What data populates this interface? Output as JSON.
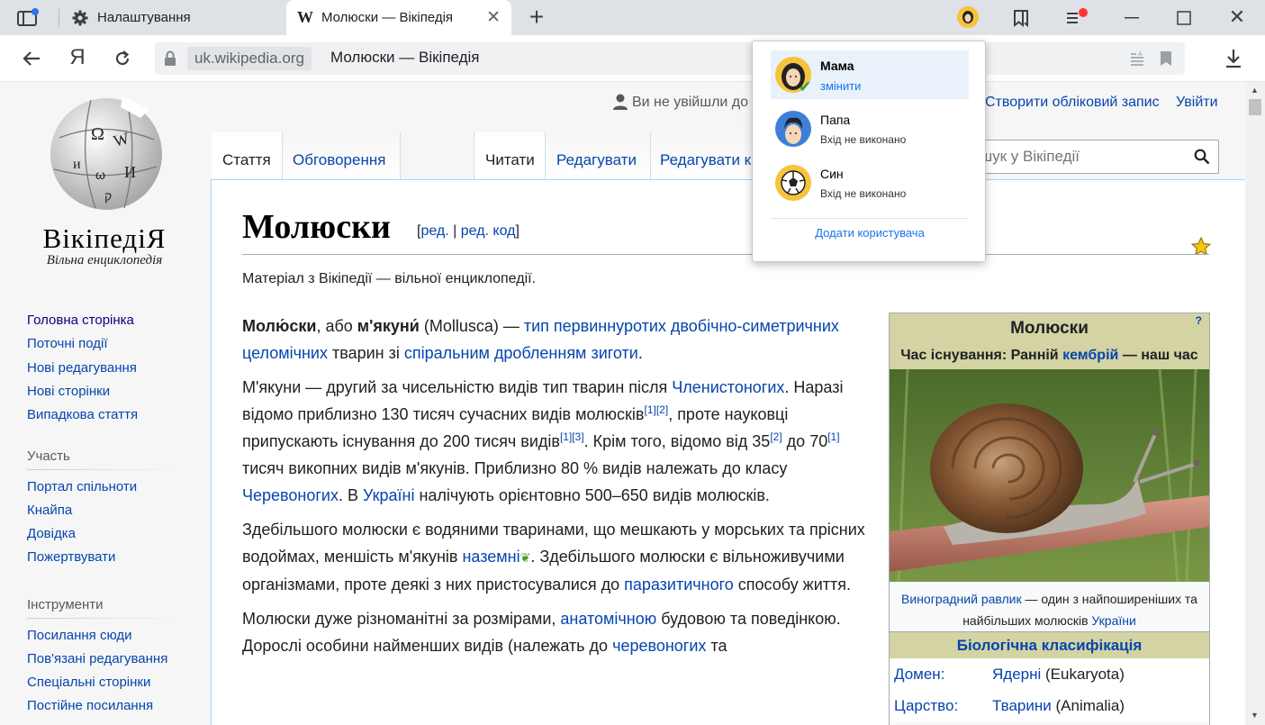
{
  "browser": {
    "tabs": [
      {
        "title": "Налаштування",
        "icon": "gear-icon"
      },
      {
        "title": "Молюски — Вікіпедія",
        "icon": "wikipedia-w-icon"
      }
    ],
    "url_domain": "uk.wikipedia.org",
    "url_title": "Молюски — Вікіпедія",
    "yandex_button": "Я"
  },
  "profile_menu": {
    "users": [
      {
        "name": "Мама",
        "status": "змінити",
        "active": true
      },
      {
        "name": "Папа",
        "status": "Вхід не виконано",
        "active": false
      },
      {
        "name": "Син",
        "status": "Вхід не виконано",
        "active": false
      }
    ],
    "add_user": "Додати користувача"
  },
  "wiki": {
    "logo_word": "ВікіпедіЯ",
    "logo_tagline": "Вільна енциклопедія",
    "user_links": {
      "not_logged": "Ви не увійшли до",
      "create_account": "Створити обліковий запис",
      "login": "Увійти"
    },
    "tabs": {
      "article": "Стаття",
      "talk": "Обговорення",
      "read": "Читати",
      "edit": "Редагувати",
      "edit_source": "Редагувати к"
    },
    "search_placeholder": "ошук у Вікіпедії",
    "sidebar": {
      "main": [
        "Головна сторінка",
        "Поточні події",
        "Нові редагування",
        "Нові сторінки",
        "Випадкова стаття"
      ],
      "participation_heading": "Участь",
      "participation": [
        "Портал спільноти",
        "Кнайпа",
        "Довідка",
        "Пожертвувати"
      ],
      "tools_heading": "Інструменти",
      "tools": [
        "Посилання сюди",
        "Пов'язані редагування",
        "Спеціальні сторінки",
        "Постійне посилання"
      ]
    },
    "title": "Молюски",
    "edit_links": {
      "edit": "ред.",
      "sep": "|",
      "edit_code": "ред. код"
    },
    "from_wiki": "Матеріал з Вікіпедії — вільної енциклопедії.",
    "infobox": {
      "title": "Молюски",
      "q": "?",
      "time_label": "Час існування: Ранній",
      "time_link": "кембрій",
      "time_end": "— наш час",
      "caption_link": "Виноградний равлик",
      "caption_text": "— один з найпоширеніших та найбільших молюсків",
      "caption_link2": "України",
      "classification": "Біологічна класифікація",
      "rows": [
        {
          "key": "Домен:",
          "link": "Ядерні",
          "rest": "(Eukaryota)"
        },
        {
          "key": "Царство:",
          "link": "Тварини",
          "rest": "(Animalia)"
        }
      ]
    }
  }
}
